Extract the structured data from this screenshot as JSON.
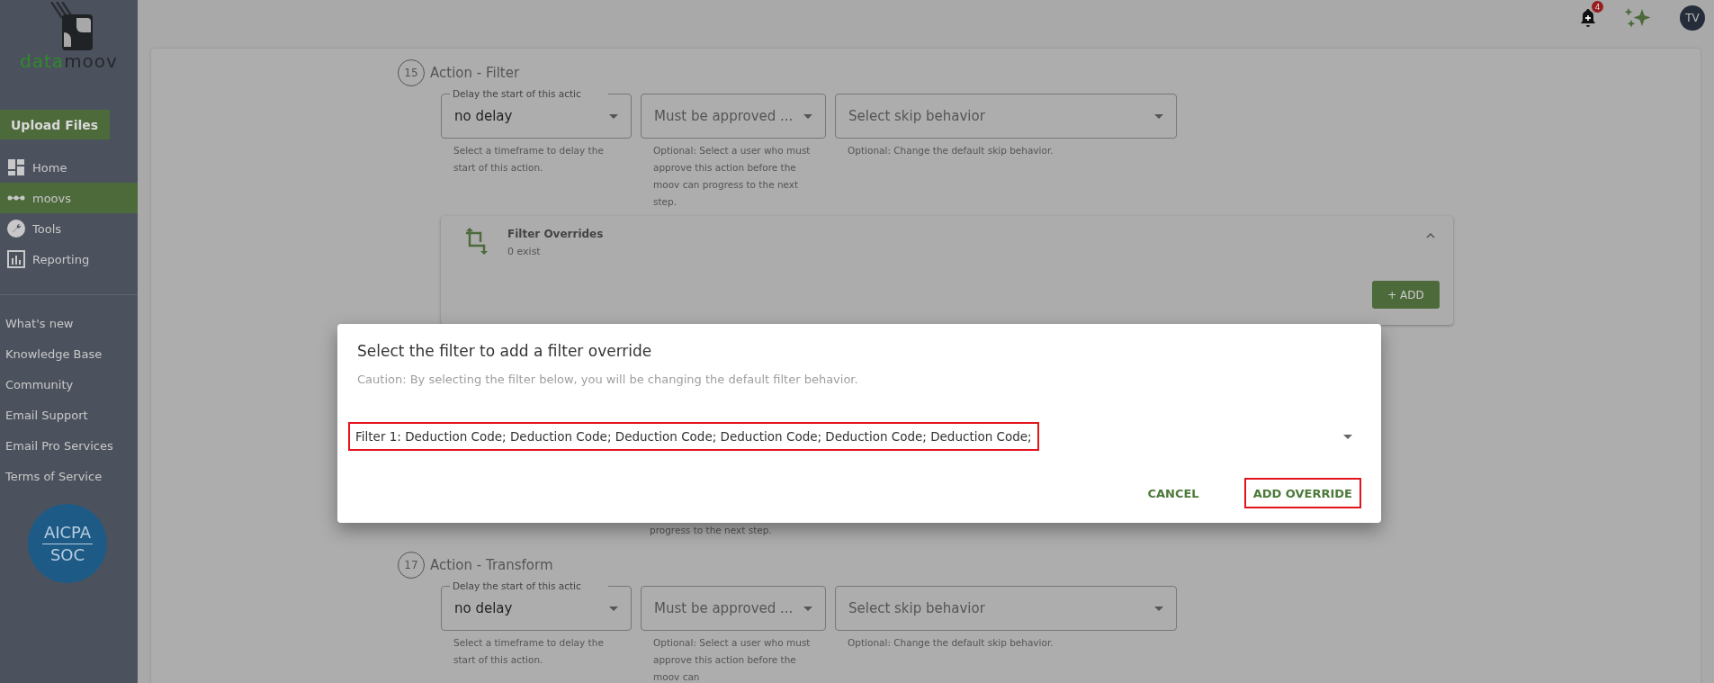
{
  "sidebar": {
    "logo": {
      "part1": "data",
      "part2": "moov"
    },
    "upload_button": "Upload Files",
    "nav": [
      {
        "label": "Home",
        "kind": "home",
        "selected": false
      },
      {
        "label": "moovs",
        "kind": "moovs",
        "selected": true
      },
      {
        "label": "Tools",
        "kind": "tools",
        "selected": false
      },
      {
        "label": "Reporting",
        "kind": "reporting",
        "selected": false
      }
    ],
    "links": [
      "What's new",
      "Knowledge Base",
      "Community",
      "Email Support",
      "Email Pro Services",
      "Terms of Service"
    ],
    "badge": {
      "line1": "AICPA",
      "line2": "SOC"
    }
  },
  "top_bar": {
    "notification_count": "4",
    "avatar": "TV"
  },
  "actions": [
    {
      "number": "15",
      "title": "Action - Filter",
      "delay": {
        "label": "Delay the start of this actic",
        "value": "no delay",
        "helper": "Select a timeframe to delay the start of this action."
      },
      "approver": {
        "placeholder": "Must be approved ...",
        "helper": "Optional: Select a user who must approve this action before the moov can progress to the next step."
      },
      "skip": {
        "placeholder": "Select skip behavior",
        "helper": "Optional: Change the default skip behavior."
      },
      "overrides": {
        "title": "Filter Overrides",
        "count": "0 exist",
        "add_button": "+ ADD",
        "expanded": true
      }
    },
    {
      "number": "17",
      "title": "Action - Transform",
      "delay": {
        "label": "Delay the start of this actic",
        "value": "no delay",
        "helper": "Select a timeframe to delay the start of this action."
      },
      "approver": {
        "placeholder": "Must be approved ...",
        "helper": "Optional: Select a user who must approve this action before the moov can"
      },
      "skip": {
        "placeholder": "Select skip behavior",
        "helper": "Optional: Change the default skip behavior."
      }
    }
  ],
  "hidden_action_helper_tail": "progress to the next step.",
  "dialog": {
    "title": "Select the filter to add a filter override",
    "caution": "Caution: By selecting the filter below, you will be changing the default filter behavior.",
    "selected_filter": "Filter 1: Deduction Code; Deduction Code; Deduction Code; Deduction Code; Deduction Code; Deduction Code;",
    "buttons": [
      {
        "label": "CANCEL",
        "highlighted": false
      },
      {
        "label": "ADD OVERRIDE",
        "highlighted": true
      }
    ]
  }
}
